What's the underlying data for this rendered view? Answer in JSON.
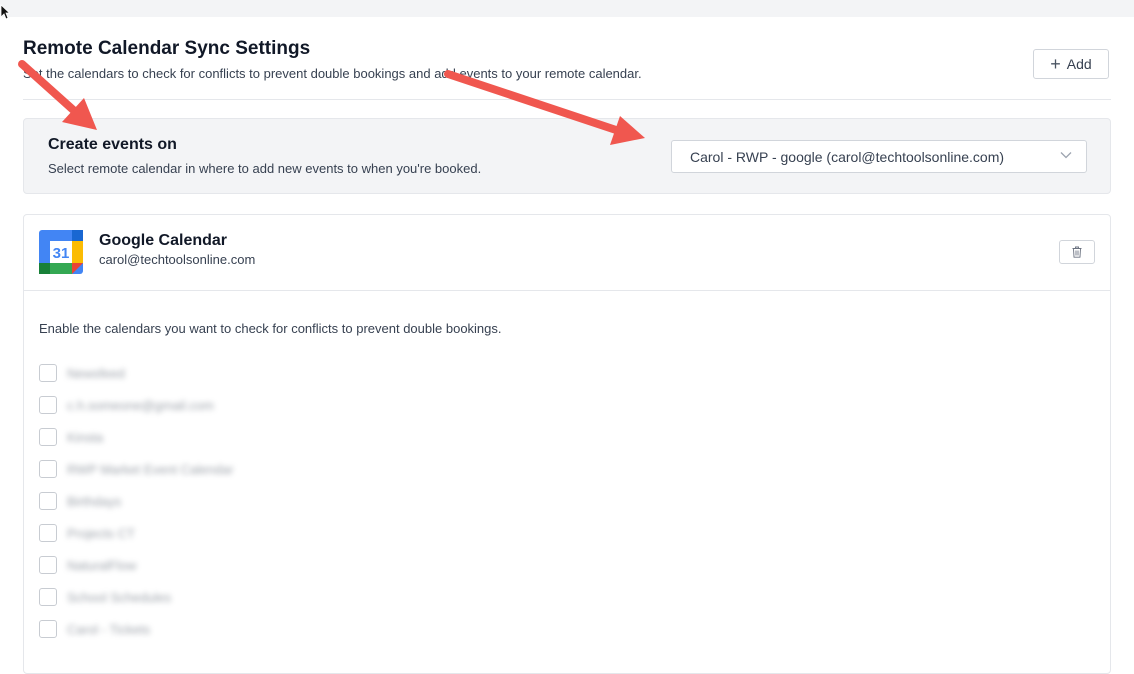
{
  "header": {
    "title": "Remote Calendar Sync Settings",
    "description": "Set the calendars to check for conflicts to prevent double bookings and add events to your remote calendar.",
    "add_label": "Add"
  },
  "create_events": {
    "title": "Create events on",
    "description": "Select remote calendar in where to add new events to when you're booked.",
    "selected_calendar": "Carol - RWP - google (carol@techtoolsonline.com)"
  },
  "google_calendar": {
    "icon_label": "31",
    "name": "Google Calendar",
    "email": "carol@techtoolsonline.com",
    "enable_text": "Enable the calendars you want to check for conflicts to prevent double bookings.",
    "calendars": [
      {
        "label": "Newsfeed",
        "checked": false
      },
      {
        "label": "c.h.someone@gmail.com",
        "checked": false
      },
      {
        "label": "Kinsta",
        "checked": false
      },
      {
        "label": "RWP Market Event Calendar",
        "checked": false
      },
      {
        "label": "Birthdays",
        "checked": false
      },
      {
        "label": "Projects CT",
        "checked": false
      },
      {
        "label": "NaturalFlow",
        "checked": false
      },
      {
        "label": "School Schedules",
        "checked": false
      },
      {
        "label": "Carol - Tickets",
        "checked": false
      }
    ]
  },
  "colors": {
    "annotation_arrow": "#f0574f",
    "panel_background": "#f3f4f6",
    "border": "#e5e7eb"
  }
}
